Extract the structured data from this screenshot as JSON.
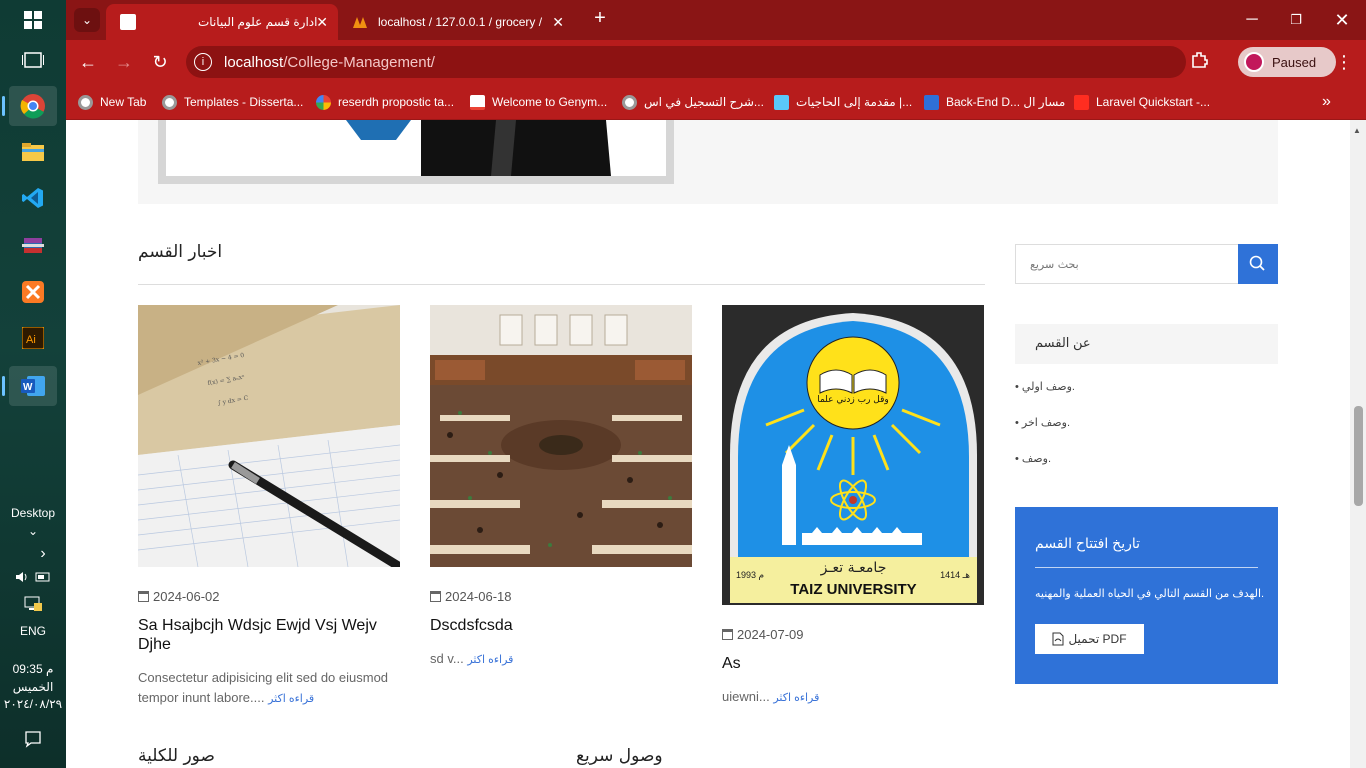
{
  "taskbar": {
    "desktop_label": "Desktop",
    "language": "ENG",
    "time": "09:35 م",
    "day": "الخميس",
    "date": "٢٠٢٤/٠٨/٢٩"
  },
  "browser": {
    "tabs": [
      {
        "title": "ادارة قسم علوم البيانات",
        "active": true
      },
      {
        "title": "localhost / 127.0.0.1 / grocery /",
        "active": false
      }
    ],
    "url_host": "localhost",
    "url_path": "/College-Management/",
    "profile_status": "Paused",
    "bookmarks": [
      "New Tab",
      "Templates - Disserta...",
      "reserdh propostic ta...",
      "Welcome to Genym...",
      "شرح التسجيل في اس...",
      "مقدمة إلى الحاجيات |...",
      "Back-End D... مسار ال",
      "Laravel Quickstart -..."
    ],
    "accent_color": "#b71c1c"
  },
  "page": {
    "news_title": "اخبار القسم",
    "cards": [
      {
        "date": "2024-06-02",
        "title": "Sa Hsajbcjh Wdsjc Ewjd Vsj Wejv Djhe",
        "excerpt": "Consectetur adipisicing elit sed do eiusmod tempor inunt labore....",
        "more": "قراءه اكثر"
      },
      {
        "date": "2024-06-18",
        "title": "Dscdsfcsda",
        "excerpt": "sd v...",
        "more": "قراءه اكثر"
      },
      {
        "date": "2024-07-09",
        "title": "As",
        "excerpt": "uiewni...",
        "more": "قراءه اكثر"
      }
    ],
    "university_logo": {
      "arabic_name": "جامعـة تعـز",
      "english_name": "TAIZ UNIVERSITY",
      "year_left": "1993 م",
      "year_right": "1414 هـ",
      "motto": "وقل رب زدني علما"
    },
    "sidebar": {
      "search_placeholder": "بحث سريع",
      "about_title": "عن القسم",
      "about_items": [
        "وصف اولي.",
        "وصف اخر.",
        "وصف."
      ],
      "history_title": "تاريخ افتتاح القسم",
      "history_text": "الهدف من القسم التالي في الحياه العملية والمهنيه.",
      "download_label": "تحميل PDF"
    },
    "bottom": {
      "gallery_title": "صور للكلية",
      "quick_access_title": "وصول سريع"
    },
    "primary_color": "#2f72d8"
  }
}
